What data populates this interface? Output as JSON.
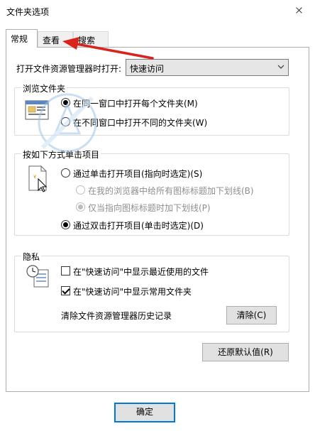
{
  "window": {
    "title": "文件夹选项"
  },
  "tabs": [
    {
      "label": "常规",
      "active": true
    },
    {
      "label": "查看",
      "active": false
    },
    {
      "label": "搜索",
      "active": false
    }
  ],
  "open_explorer": {
    "label": "打开文件资源管理器时打开:",
    "selected": "快速访问"
  },
  "browse_folders": {
    "title": "浏览文件夹",
    "options": [
      {
        "label": "在同一窗口中打开每个文件夹(M)",
        "checked": true
      },
      {
        "label": "在不同窗口中打开不同的文件夹(W)",
        "checked": false
      }
    ]
  },
  "click_items": {
    "title": "按如下方式单击项目",
    "options": [
      {
        "label": "通过单击打开项目(指向时选定)(S)",
        "checked": false
      },
      {
        "label": "在我的浏览器中给所有图标标题加下划线(B)",
        "checked": false,
        "disabled": true
      },
      {
        "label": "仅当指向图标标题时加下划线(P)",
        "checked": true,
        "disabled": true
      },
      {
        "label": "通过双击打开项目(单击时选定)(D)",
        "checked": true
      }
    ]
  },
  "privacy": {
    "title": "隐私",
    "options": [
      {
        "label": "在\"快速访问\"中显示最近使用的文件",
        "checked": false
      },
      {
        "label": "在\"快速访问\"中显示常用文件夹",
        "checked": true
      }
    ],
    "clear_history_label": "清除文件资源管理器历史记录",
    "clear_button": "清除(C)"
  },
  "restore_defaults_button": "还原默认值(R)",
  "ok_button": "确定",
  "colors": {
    "accent": "#0078d7",
    "annotation_arrow": "#d9241e"
  },
  "icons": {
    "browse": "folder-windows-icon",
    "click": "document-cursor-icon",
    "privacy": "clock-document-icon",
    "dropdown": "chevron-down-icon",
    "close": "close-icon"
  }
}
